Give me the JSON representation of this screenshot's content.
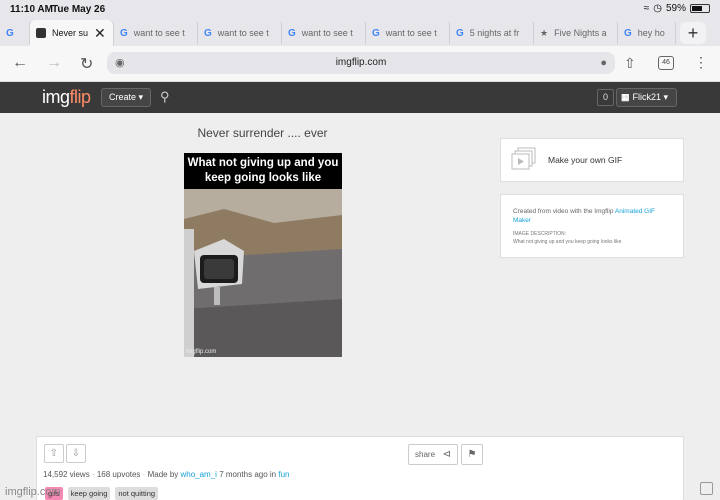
{
  "status": {
    "time": "11:10 AM",
    "date": "Tue May 26",
    "battery": "59%"
  },
  "tabs": [
    {
      "label": "Never su",
      "active": true
    },
    {
      "label": "want to see t"
    },
    {
      "label": "want to see t"
    },
    {
      "label": "want to see t"
    },
    {
      "label": "want to see t"
    },
    {
      "label": "5 nights at fr"
    },
    {
      "label": "Five Nights a"
    },
    {
      "label": "hey ho"
    }
  ],
  "browser": {
    "url": "imgflip.com",
    "tab_count": "46"
  },
  "header": {
    "logo_img": "img",
    "logo_flip": "flip",
    "create_label": "Create",
    "notif_count": "0",
    "username": "Flick21"
  },
  "meme": {
    "title": "Never surrender .... ever",
    "caption": "What not giving up and you keep going looks like",
    "watermark": "imgflip.com"
  },
  "sidebar": {
    "make_gif": "Make your own GIF",
    "created_prefix": "Created from video with the Imgflip ",
    "created_link": "Animated GIF Maker",
    "desc_label": "IMAGE DESCRIPTION:",
    "desc_text": "What not giving up and you keep going looks like"
  },
  "actions": {
    "share_label": "share"
  },
  "stats": {
    "views": "14,592 views",
    "upvotes": "168 upvotes",
    "made_by_prefix": "Made by ",
    "author": "who_am_i",
    "time": "7 months ago",
    "in_label": "in",
    "stream": "fun"
  },
  "tags": [
    "gifs",
    "keep going",
    "not quitting"
  ],
  "footer": {
    "watermark": "imgflip.com"
  }
}
